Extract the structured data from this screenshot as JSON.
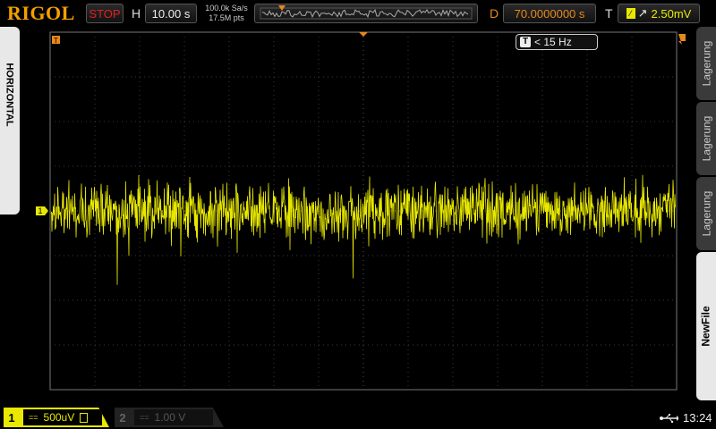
{
  "header": {
    "logo": "RIGOL",
    "run_state": "STOP",
    "horizontal_label": "H",
    "timebase": "10.00 s",
    "sample_rate": "100.0k Sa/s",
    "memory_depth": "17.5M pts",
    "delay_label": "D",
    "delay_value": "70.0000000 s",
    "trigger_label": "T",
    "trigger_level": "2.50mV"
  },
  "left_tab": {
    "label": "HORIZONTAL"
  },
  "right_tabs": [
    {
      "label": "Lagerung",
      "active": false
    },
    {
      "label": "Lagerung",
      "active": false
    },
    {
      "label": "Lagerung",
      "active": false
    },
    {
      "label": "NewFile",
      "active": true
    }
  ],
  "display": {
    "trigger_freq_label": "T",
    "trigger_freq": "< 15 Hz",
    "channel1_marker": "1",
    "trace_color": "#e8e800",
    "grid_color": "#3a3a3a"
  },
  "footer": {
    "ch1_number": "1",
    "ch1_coupling": "==",
    "ch1_scale": "500uV",
    "ch2_number": "2",
    "ch2_coupling": "==",
    "ch2_scale": "1.00 V",
    "time": "13:24"
  },
  "icons": [
    "usb-icon",
    "trigger-edge-icon",
    "bandwidth-limit-icon"
  ]
}
